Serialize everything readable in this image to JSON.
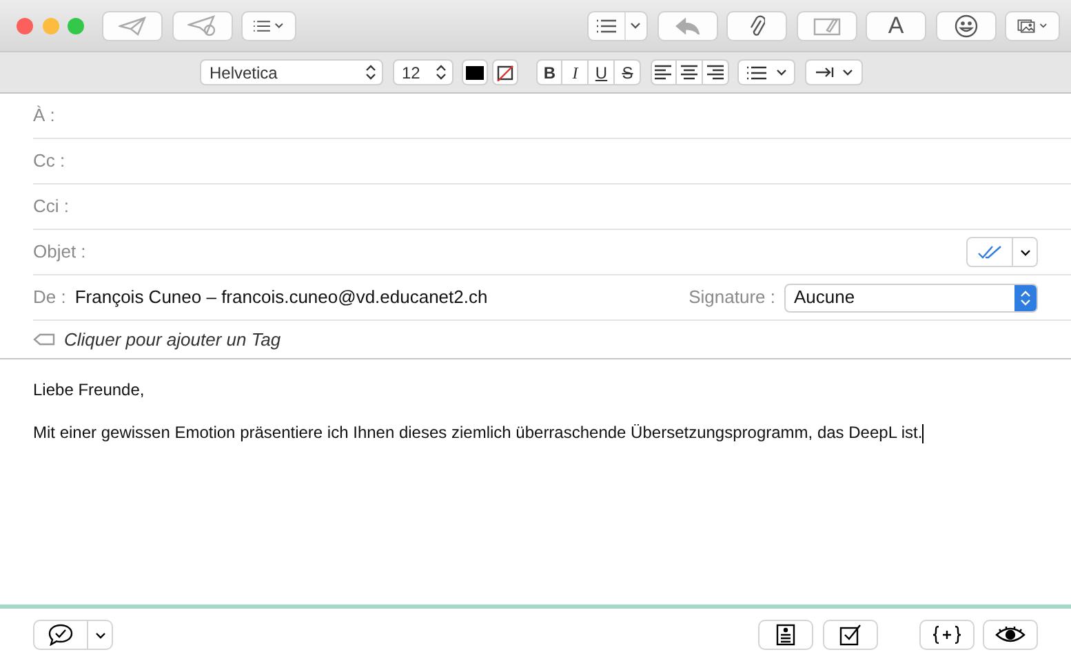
{
  "toolbar": [
    {
      "kind": "send",
      "disabled": true
    },
    {
      "kind": "send-later",
      "disabled": true
    },
    {
      "kind": "list-menu",
      "disabled": false
    },
    {
      "kind": "list-split",
      "disabled": false
    },
    {
      "kind": "reply",
      "disabled": true
    },
    {
      "kind": "attach",
      "disabled": false
    },
    {
      "kind": "markup",
      "disabled": true
    },
    {
      "kind": "font",
      "label": "A",
      "disabled": false
    },
    {
      "kind": "emoji",
      "disabled": false
    },
    {
      "kind": "photo",
      "disabled": false
    }
  ],
  "format_bar": {
    "font": "Helvetica",
    "size": "12",
    "styles": [
      {
        "label": "B",
        "kind": "bold"
      },
      {
        "label": "I",
        "kind": "italic"
      },
      {
        "label": "U",
        "kind": "underline"
      },
      {
        "label": "S",
        "kind": "strike"
      }
    ]
  },
  "fields": [
    {
      "label": "À :"
    },
    {
      "label": "Cc :"
    },
    {
      "label": "Cci :"
    },
    {
      "label": "Objet :"
    }
  ],
  "from": {
    "label": "De :",
    "value": "François Cuneo – francois.cuneo@vd.educanet2.ch",
    "signature_label": "Signature :",
    "signature": "Aucune"
  },
  "tag": {
    "text": "Cliquer pour ajouter un Tag"
  },
  "body": [
    "Liebe Freunde,",
    "Mit einer gewissen Emotion präsentiere ich Ihnen dieses ziemlich überraschende Übersetzungsprogramm, das DeepL ist."
  ]
}
